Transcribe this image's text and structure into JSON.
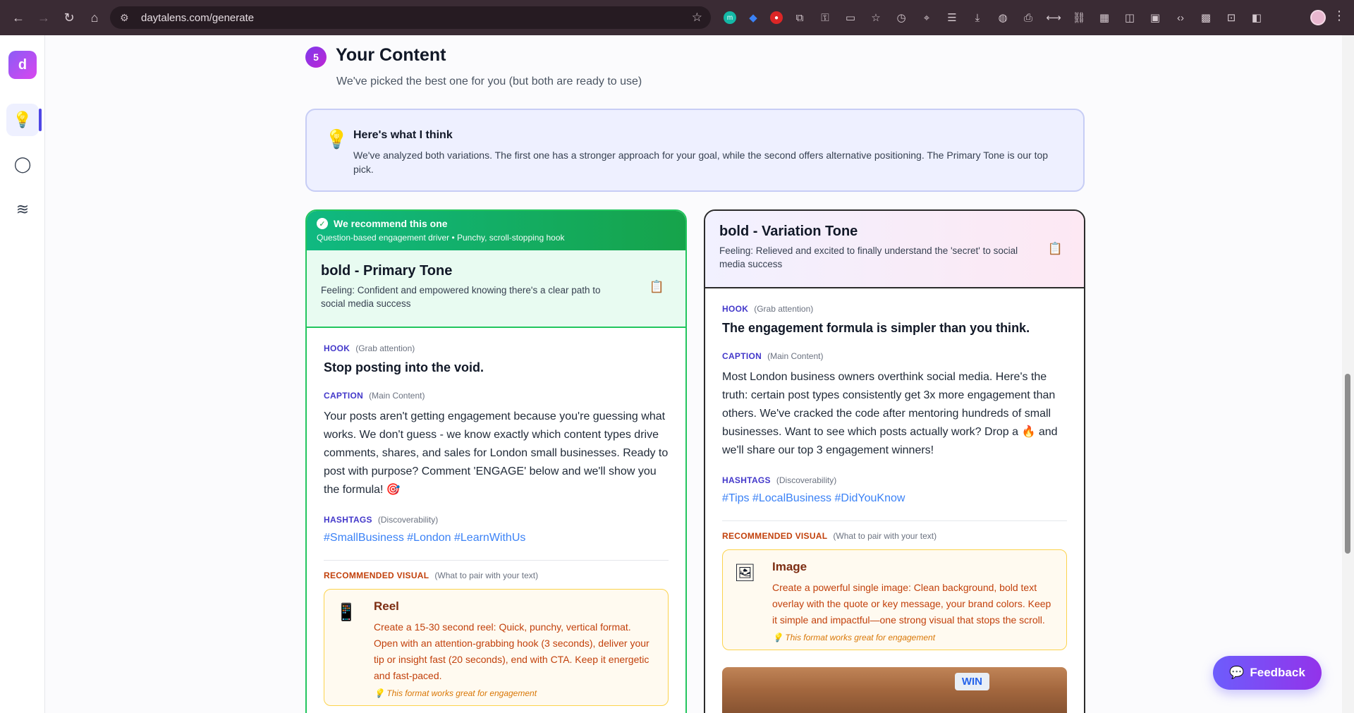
{
  "browser": {
    "url": "daytalens.com/generate"
  },
  "sidebar": {
    "logo_letter": "d"
  },
  "section": {
    "step_number": "5",
    "title": "Your Content",
    "subtitle": "We've picked the best one for you (but both are ready to use)"
  },
  "insight": {
    "title": "Here's what I think",
    "text": "We've analyzed both variations. The first one has a stronger approach for your goal, while the second offers alternative positioning. The Primary Tone is our top pick."
  },
  "labels": {
    "hook": "HOOK",
    "hook_sub": "(Grab attention)",
    "caption": "CAPTION",
    "caption_sub": "(Main Content)",
    "hashtags": "HASHTAGS",
    "hashtags_sub": "(Discoverability)",
    "visual": "RECOMMENDED VISUAL",
    "visual_sub": "(What to pair with your text)"
  },
  "primary": {
    "badge": "We recommend this one",
    "badge_sub": "Question-based engagement driver • Punchy, scroll-stopping hook",
    "title": "bold - Primary Tone",
    "feeling": "Feeling: Confident and empowered knowing there's a clear path to social media success",
    "hook": "Stop posting into the void.",
    "caption": "Your posts aren't getting engagement because you're guessing what works. We don't guess - we know exactly which content types drive comments, shares, and sales for London small businesses. Ready to post with purpose? Comment 'ENGAGE' below and we'll show you the formula! 🎯",
    "hashtags": "#SmallBusiness #London #LearnWithUs",
    "visual_title": "Reel",
    "visual_desc": "Create a 15-30 second reel: Quick, punchy, vertical format. Open with an attention-grabbing hook (3 seconds), deliver your tip or insight fast (20 seconds), end with CTA. Keep it energetic and fast-paced.",
    "visual_note": "💡 This format works great for engagement"
  },
  "variation": {
    "title": "bold - Variation Tone",
    "feeling": "Feeling: Relieved and excited to finally understand the 'secret' to social media success",
    "hook": "The engagement formula is simpler than you think.",
    "caption": "Most London business owners overthink social media. Here's the truth: certain post types consistently get 3x more engagement than others. We've cracked the code after mentoring hundreds of small businesses. Want to see which posts actually work? Drop a 🔥 and we'll share our top 3 engagement winners!",
    "hashtags": "#Tips #LocalBusiness #DidYouKnow",
    "visual_title": "Image",
    "visual_desc": "Create a powerful single image: Clean background, bold text overlay with the quote or key message, your brand colors. Keep it simple and impactful—one strong visual that stops the scroll.",
    "visual_note": "💡 This format works great for engagement",
    "preview_text": "WIN"
  },
  "feedback": {
    "label": "Feedback"
  },
  "colors": {
    "accent": "#4f46e5",
    "recommended_green": "#22c55e",
    "hashtag_blue": "#3b82f6"
  }
}
